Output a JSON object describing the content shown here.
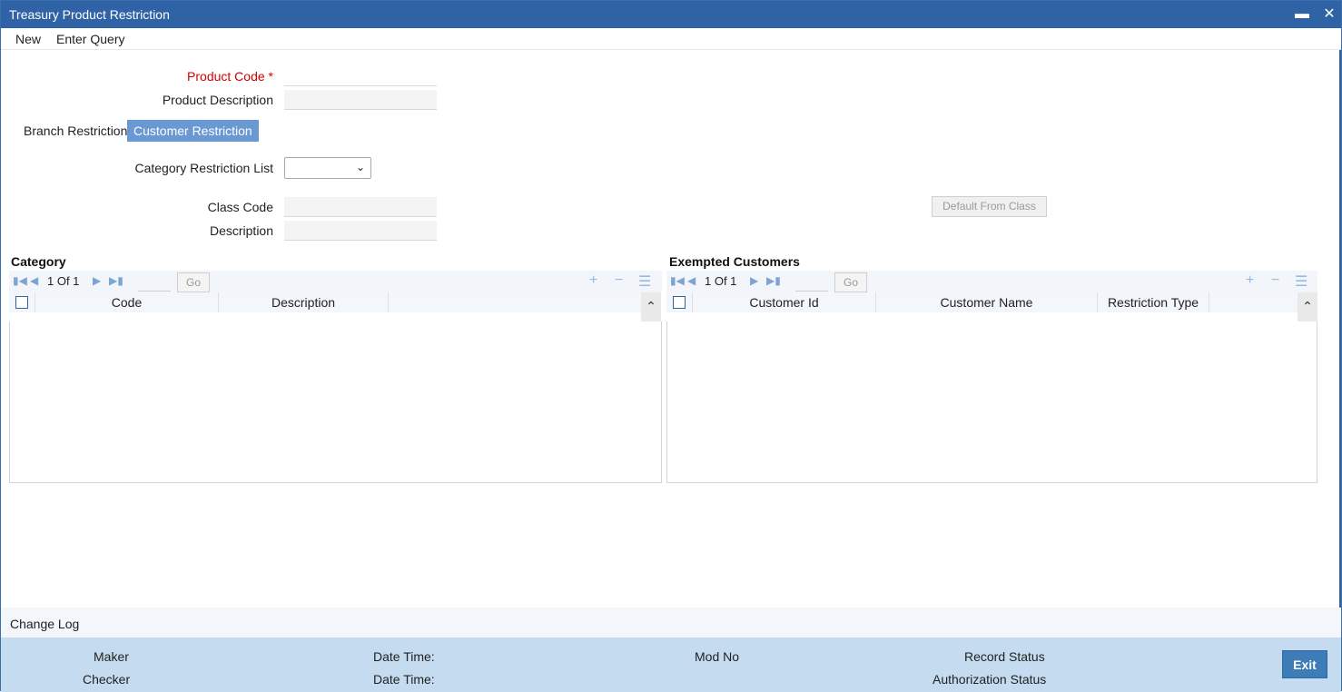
{
  "window": {
    "title": "Treasury Product Restriction",
    "minimize_glyph": "▬",
    "close_glyph": "✕"
  },
  "menu": {
    "items": [
      "New",
      "Enter Query"
    ]
  },
  "form": {
    "product_code_label": "Product Code",
    "required_marker": "*",
    "product_code_value": "",
    "product_description_label": "Product Description",
    "product_description_value": "",
    "tabs": [
      "Branch Restriction",
      "Customer Restriction"
    ],
    "active_tab": "Customer Restriction",
    "category_restriction_list_label": "Category Restriction List",
    "category_restriction_list_value": "",
    "class_code_label": "Class Code",
    "class_code_value": "",
    "description_label": "Description",
    "description_value": "",
    "default_from_class_label": "Default From Class"
  },
  "category_grid": {
    "title": "Category",
    "pager": "1 Of 1",
    "go_label": "Go",
    "columns": [
      "Code",
      "Description"
    ],
    "rows": []
  },
  "exempted_grid": {
    "title": "Exempted Customers",
    "pager": "1 Of 1",
    "go_label": "Go",
    "columns": [
      "Customer Id",
      "Customer Name",
      "Restriction Type"
    ],
    "rows": []
  },
  "change_log": {
    "label": "Change Log"
  },
  "footer": {
    "maker_label": "Maker",
    "checker_label": "Checker",
    "date_time_label_1": "Date Time:",
    "date_time_label_2": "Date Time:",
    "mod_no_label": "Mod No",
    "record_status_label": "Record Status",
    "authorization_status_label": "Authorization Status",
    "exit_label": "Exit"
  },
  "colors": {
    "titlebar": "#2f63a6",
    "active_tab": "#6a98d3",
    "footer": "#c5dbef",
    "required": "#d40000",
    "exit_button": "#3e7cb7"
  }
}
